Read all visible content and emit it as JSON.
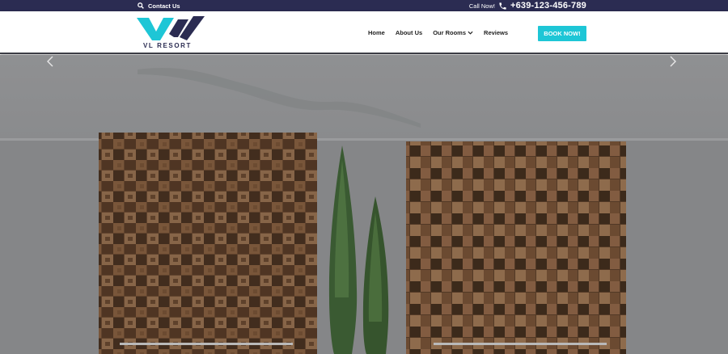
{
  "topbar": {
    "contact_label": "Contact Us",
    "call_label": "Call Now!",
    "phone": "+639-123-456-789"
  },
  "brand": {
    "name": "VL RESORT",
    "colors": {
      "teal": "#1ec6d6",
      "navy": "#2b2c52"
    }
  },
  "nav": {
    "items": [
      {
        "label": "Home"
      },
      {
        "label": "About Us"
      },
      {
        "label": "Our Rooms"
      },
      {
        "label": "Reviews"
      }
    ],
    "book_label": "BOOK NOW!"
  },
  "hero": {
    "prev_icon": "chevron-left-icon",
    "next_icon": "chevron-right-icon"
  }
}
